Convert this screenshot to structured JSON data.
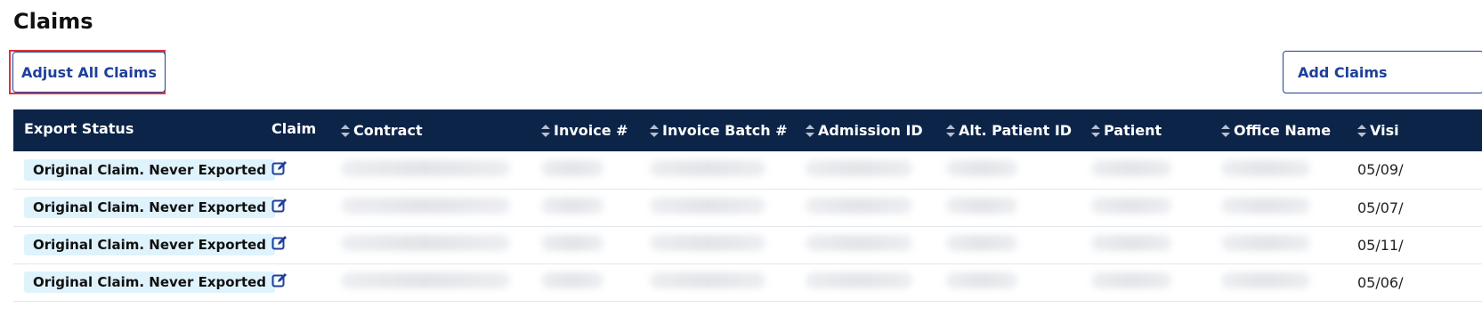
{
  "page": {
    "title": "Claims"
  },
  "toolbar": {
    "adjust_all_label": "Adjust All Claims",
    "add_claims_label": "Add Claims"
  },
  "table": {
    "columns": [
      {
        "label": "Export Status",
        "sortable": false
      },
      {
        "label": "Claim",
        "sortable": false
      },
      {
        "label": "Contract",
        "sortable": true
      },
      {
        "label": "Invoice #",
        "sortable": true
      },
      {
        "label": "Invoice Batch #",
        "sortable": true
      },
      {
        "label": "Admission ID",
        "sortable": true
      },
      {
        "label": "Alt. Patient ID",
        "sortable": true
      },
      {
        "label": "Patient",
        "sortable": true
      },
      {
        "label": "Office Name",
        "sortable": true
      },
      {
        "label": "Visi",
        "sortable": true
      }
    ],
    "rows": [
      {
        "export_status": "Original Claim. Never Exported",
        "visit": "05/09/"
      },
      {
        "export_status": "Original Claim. Never Exported",
        "visit": "05/07/"
      },
      {
        "export_status": "Original Claim. Never Exported",
        "visit": "05/11/"
      },
      {
        "export_status": "Original Claim. Never Exported",
        "visit": "05/06/"
      }
    ]
  },
  "colors": {
    "header_bg": "#0c2448",
    "accent": "#1f3f9a",
    "badge_bg": "#dff3fc",
    "focus_ring": "#d9363e"
  },
  "icons": {
    "edit": "edit-icon",
    "sort": "sort-icon"
  }
}
